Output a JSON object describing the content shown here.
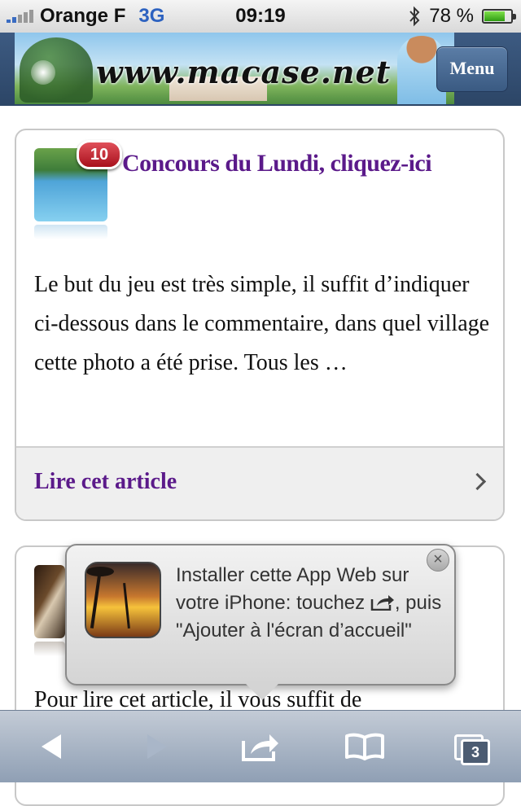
{
  "status_bar": {
    "carrier": "Orange F",
    "network": "3G",
    "time": "09:19",
    "battery_percent": "78 %",
    "battery_level": 0.78
  },
  "header": {
    "logo_text": "www.macase.net",
    "menu_label": "Menu"
  },
  "articles": [
    {
      "comment_count": "10",
      "title": "Concours du Lundi, cliquez-ici",
      "excerpt": "Le but du jeu est très simple, il suffit d’indiquer ci-dessous dans le commentaire, dans quel village cette photo a été prise. Tous les …",
      "read_more": "Lire cet article"
    },
    {
      "excerpt": "Pour lire cet article, il vous suffit de"
    }
  ],
  "install_popup": {
    "text_part1": "Installer cette App Web sur votre iPhone: touchez ",
    "text_part2": ", puis \"Ajouter à l'écran d’accueil\"",
    "close_symbol": "×"
  },
  "toolbar": {
    "tabs_count": "3"
  },
  "colors": {
    "title_purple": "#5b1a8a",
    "header_blue": "#2c4566",
    "badge_red": "#a8101c"
  }
}
